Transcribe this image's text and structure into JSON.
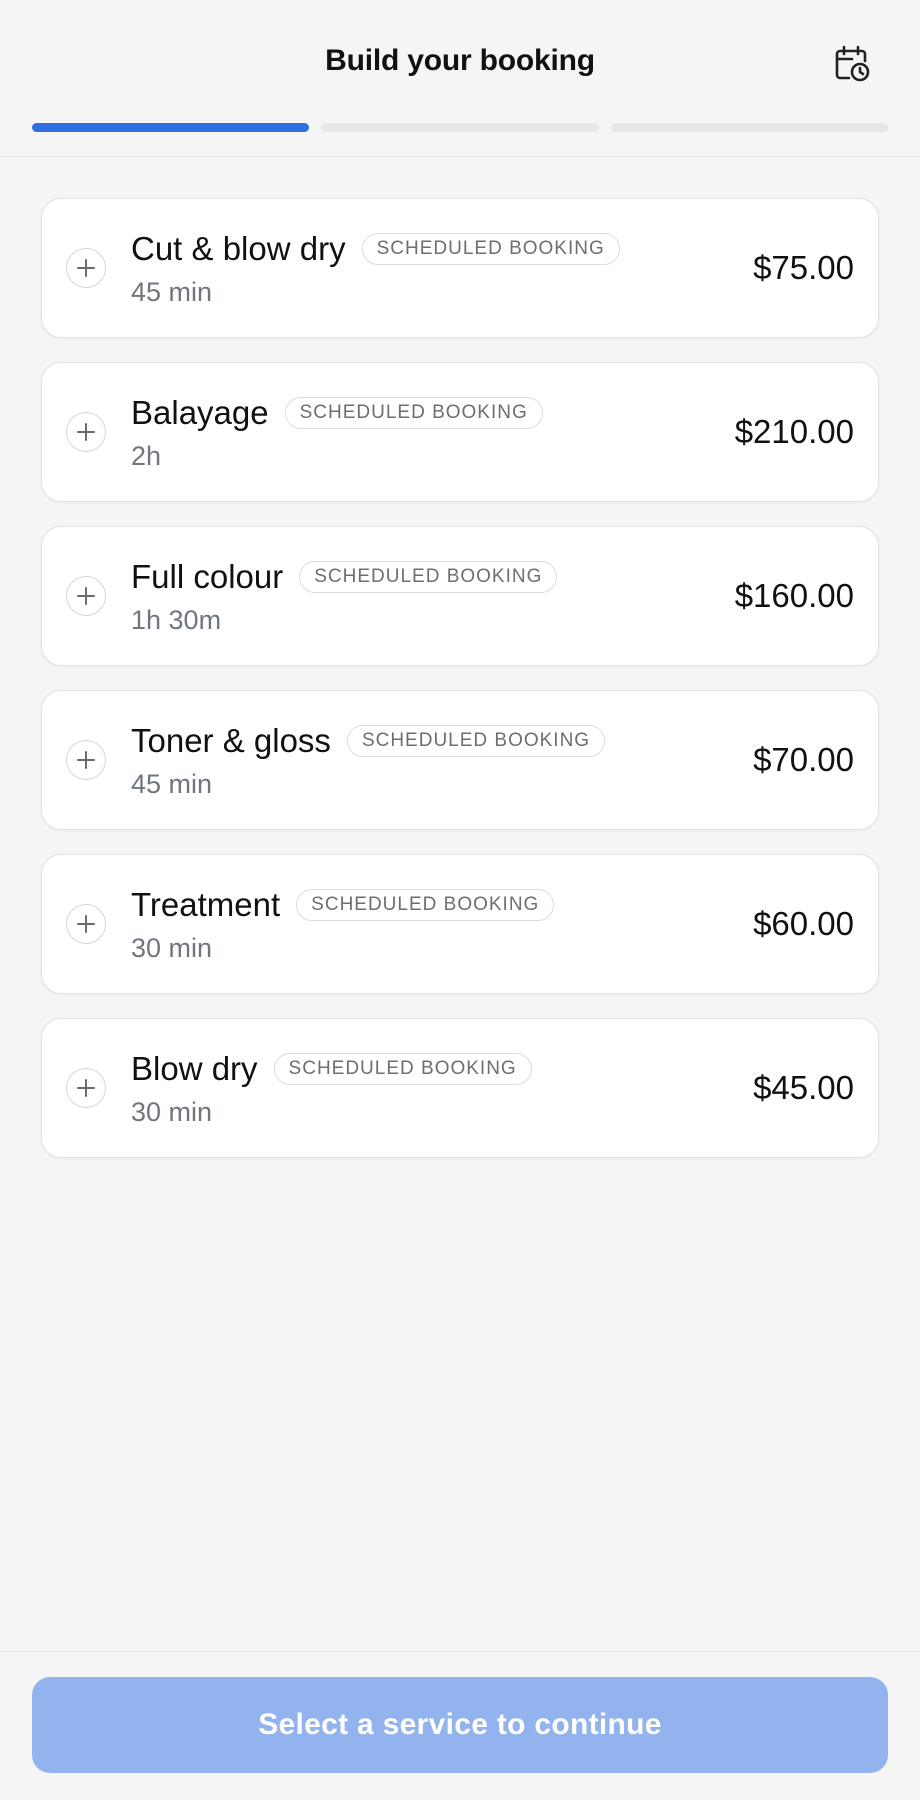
{
  "header": {
    "title": "Build your booking",
    "calendar_icon": "calendar-clock-icon"
  },
  "progress": {
    "steps_total": 3,
    "current_step": 1
  },
  "services": [
    {
      "name": "Cut & blow dry",
      "badge": "SCHEDULED BOOKING",
      "duration": "45 min",
      "price": "$75.00"
    },
    {
      "name": "Balayage",
      "badge": "SCHEDULED BOOKING",
      "duration": "2h",
      "price": "$210.00"
    },
    {
      "name": "Full colour",
      "badge": "SCHEDULED BOOKING",
      "duration": "1h 30m",
      "price": "$160.00"
    },
    {
      "name": "Toner & gloss",
      "badge": "SCHEDULED BOOKING",
      "duration": "45 min",
      "price": "$70.00"
    },
    {
      "name": "Treatment",
      "badge": "SCHEDULED BOOKING",
      "duration": "30 min",
      "price": "$60.00"
    },
    {
      "name": "Blow dry",
      "badge": "SCHEDULED BOOKING",
      "duration": "30 min",
      "price": "$45.00"
    }
  ],
  "footer": {
    "continue_label": "Select a service to continue",
    "continue_enabled": false
  },
  "colors": {
    "accent": "#2f6fe0",
    "button_disabled": "#93b3ef",
    "background": "#f5f5f5"
  }
}
